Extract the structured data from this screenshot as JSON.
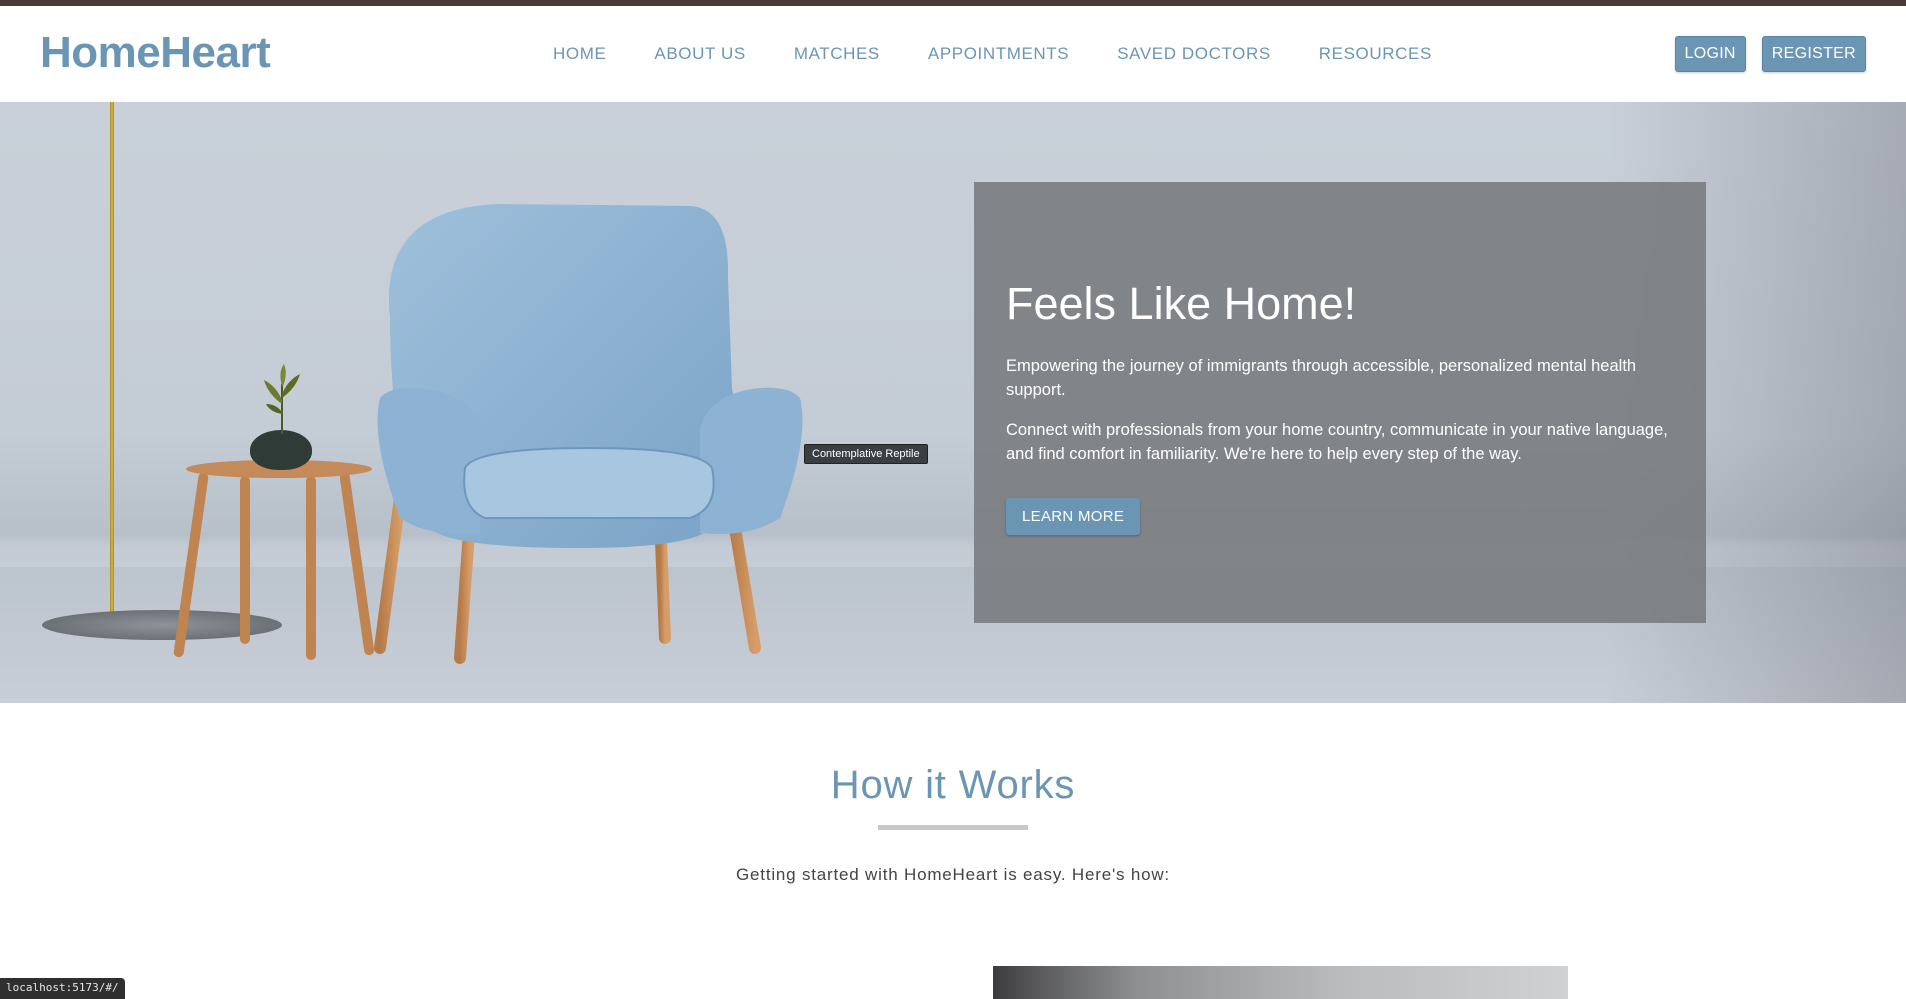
{
  "brand": {
    "name": "HomeHeart"
  },
  "nav": {
    "items": [
      "HOME",
      "ABOUT US",
      "MATCHES",
      "APPOINTMENTS",
      "SAVED DOCTORS",
      "RESOURCES"
    ]
  },
  "auth": {
    "login_label": "LOGIN",
    "register_label": "REGISTER"
  },
  "hero": {
    "tooltip": "Contemplative Reptile",
    "title": "Feels Like Home!",
    "paragraph1": "Empowering the journey of immigrants through accessible, personalized mental health support.",
    "paragraph2": "Connect with professionals from your home country, communicate in your native language, and find comfort in familiarity. We're here to help every step of the way.",
    "cta_label": "LEARN MORE"
  },
  "how": {
    "title": "How it Works",
    "subtitle": "Getting started with HomeHeart is easy. Here's how:"
  },
  "status_bar": {
    "url": "localhost:5173/#/"
  },
  "colors": {
    "accent": "#6a96b4",
    "topbar": "#4a3a38",
    "panel": "#76787c"
  }
}
